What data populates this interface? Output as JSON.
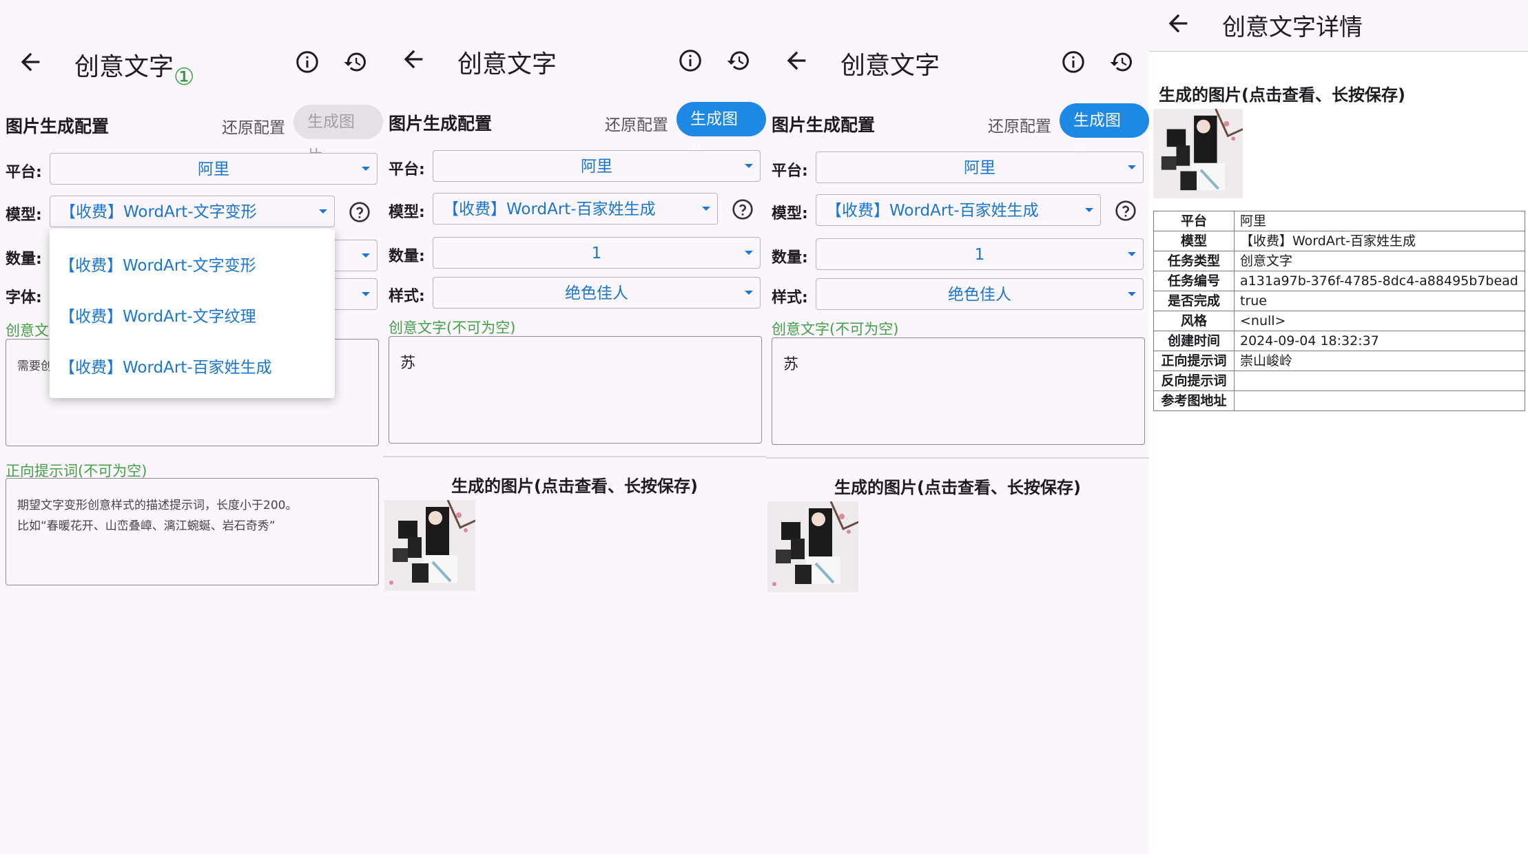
{
  "screen1": {
    "title": "创意文字",
    "badge": "①",
    "section_title": "图片生成配置",
    "reset_label": "还原配置",
    "generate_label": "生成图片",
    "platform_label": "平台:",
    "platform_value": "阿里",
    "model_label": "模型:",
    "model_value": "【收费】WordArt-文字变形",
    "count_label": "数量:",
    "font_label": "字体:",
    "text_field_label": "创意文",
    "text_placeholder": "需要创",
    "prompt_label": "正向提示词(不可为空)",
    "prompt_placeholder_line1": "期望文字变形创意样式的描述提示词，长度小于200。",
    "prompt_placeholder_line2": "比如“春暖花开、山峦叠嶂、漓江蜿蜒、岩石奇秀”",
    "dropdown_options": [
      "【收费】WordArt-文字变形",
      "【收费】WordArt-文字纹理",
      "【收费】WordArt-百家姓生成"
    ]
  },
  "screen2": {
    "title": "创意文字",
    "section_title": "图片生成配置",
    "reset_label": "还原配置",
    "generate_label": "生成图片",
    "platform_label": "平台:",
    "platform_value": "阿里",
    "model_label": "模型:",
    "model_value": "【收费】WordArt-百家姓生成",
    "count_label": "数量:",
    "count_value": "1",
    "style_label": "样式:",
    "style_value": "绝色佳人",
    "text_field_label": "创意文字(不可为空)",
    "text_value": "苏",
    "result_title": "生成的图片(点击查看、长按保存)"
  },
  "screen3": {
    "title": "创意文字",
    "section_title": "图片生成配置",
    "reset_label": "还原配置",
    "generate_label": "生成图片",
    "platform_label": "平台:",
    "platform_value": "阿里",
    "model_label": "模型:",
    "model_value": "【收费】WordArt-百家姓生成",
    "count_label": "数量:",
    "count_value": "1",
    "style_label": "样式:",
    "style_value": "绝色佳人",
    "text_field_label": "创意文字(不可为空)",
    "text_value": "苏",
    "result_title": "生成的图片(点击查看、长按保存)"
  },
  "screen4": {
    "title": "创意文字详情",
    "result_title": "生成的图片(点击查看、长按保存)",
    "rows": [
      {
        "key": "平台",
        "value": "阿里"
      },
      {
        "key": "模型",
        "value": "【收费】WordArt-百家姓生成"
      },
      {
        "key": "任务类型",
        "value": "创意文字"
      },
      {
        "key": "任务编号",
        "value": "a131a97b-376f-4785-8dc4-a88495b7bead"
      },
      {
        "key": "是否完成",
        "value": "true"
      },
      {
        "key": "风格",
        "value": "<null>"
      },
      {
        "key": "创建时间",
        "value": "2024-09-04 18:32:37"
      },
      {
        "key": "正向提示词",
        "value": "崇山峻岭"
      },
      {
        "key": "反向提示词",
        "value": ""
      },
      {
        "key": "参考图地址",
        "value": ""
      }
    ]
  },
  "colors": {
    "accent": "#1e88e5",
    "select_text": "#1976d2",
    "green_label": "#43a047",
    "background": "#fbf5fc"
  },
  "icons": [
    "back-arrow-icon",
    "info-icon",
    "history-icon",
    "help-icon",
    "dropdown-caret-icon"
  ]
}
